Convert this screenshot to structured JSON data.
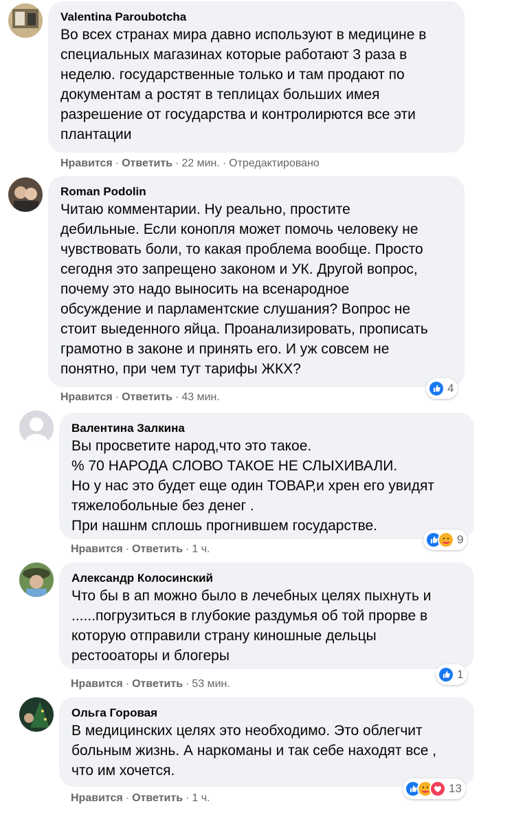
{
  "colors": {
    "bubble": "#f0f2f5",
    "meta": "#65676b",
    "like": "#1877f2",
    "care": "#f7b125",
    "love": "#f33e58"
  },
  "labels": {
    "like": "Нравится",
    "reply": "Ответить",
    "sep": "·"
  },
  "comments": [
    {
      "author": "Valentina Paroubotcha",
      "text": "Во всех странах мира давно используют в медицине в\nспециальных магазинах которые работают 3 раза в\nнеделю. государственные только и там продают по\nдокументам а ростят в теплицах больших имея\nразрешение от государства и контролирются все эти\nплантации",
      "time": "22 мин.",
      "edited": "Отредактировано",
      "reactions": [],
      "reaction_count": ""
    },
    {
      "author": "Roman Podolin",
      "text": "Читаю комментарии. Ну реально, простите\nдебильные. Если конопля может помочь человеку не\nчувствовать боли, то какая проблема вообще. Просто\nсегодня это запрещено законом и УК. Другой вопрос,\nпочему это надо выносить на всенародное\nобсуждение и парламентские слушания? Вопрос не\nстоит выеденного яйца. Проанализировать, прописать\nграмотно в законе и принять его. И уж совсем не\nпонятно, при чем тут тарифы ЖКХ?",
      "time": "43 мин.",
      "reactions": [
        "like-icon"
      ],
      "reaction_count": "4"
    },
    {
      "author": "Валентина Залкина",
      "text": "Вы просветите народ,что это такое.\n% 70 НАРОДА СЛОВО ТАКОЕ НЕ СЛЫХИВАЛИ.\nНо у нас это будет еще один ТОВАР,и хрен его увидят\nтяжелобольные без денег .\nПри нашнм сплошь прогнившем государстве.",
      "time": "1 ч.",
      "reactions": [
        "like-icon",
        "care-icon"
      ],
      "reaction_count": "9"
    },
    {
      "author": "Александр Колосинский",
      "text": "Что бы в ап можно было в лечебных целях пыхнуть и\n......погрузиться в глубокие раздумья об той прорве в\nкоторую отправили страну киношные дельцы\nрестооаторы и блогеры",
      "time": "53 мин.",
      "reactions": [
        "like-icon"
      ],
      "reaction_count": "1"
    },
    {
      "author": "Ольга Горовая",
      "text": "В медицинских целях это необходимо. Это облегчит\nбольным жизнь. А наркоманы и так себе находят все ,\nчто им хочется.",
      "time": "1 ч.",
      "reactions": [
        "like-icon",
        "care-icon",
        "love-icon"
      ],
      "reaction_count": "13"
    }
  ]
}
